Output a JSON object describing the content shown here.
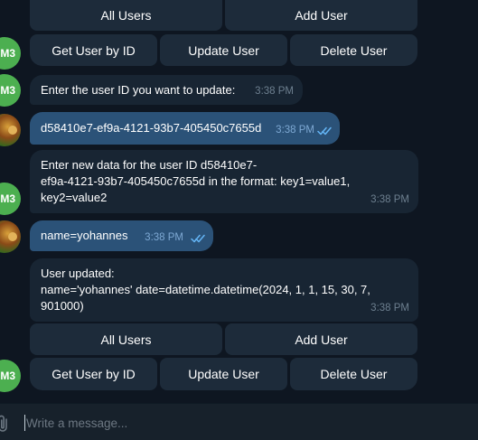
{
  "colors": {
    "background": "#0e1621",
    "incoming_bubble": "#182533",
    "outgoing_bubble": "#2b5278",
    "keyboard_button": "#1d2b3a",
    "bot_avatar": "#4caf50",
    "read_ticks": "#64b5f6"
  },
  "bot": {
    "avatar_initials": "M3"
  },
  "keyboard_top": {
    "row1": [
      "All Users",
      "Add User"
    ],
    "row2": [
      "Get User by ID",
      "Update User",
      "Delete User"
    ]
  },
  "messages": [
    {
      "from": "bot",
      "text": "Enter the user ID you want to update:",
      "time": "3:38 PM"
    },
    {
      "from": "user",
      "text": "d58410e7-ef9a-4121-93b7-405450c7655d",
      "time": "3:38 PM",
      "status": "read"
    },
    {
      "from": "bot",
      "text": "Enter new data for the user ID d58410e7-\nef9a-4121-93b7-405450c7655d in the format: key1=value1,\nkey2=value2",
      "time": "3:38 PM"
    },
    {
      "from": "user",
      "text": "name=yohannes",
      "time": "3:38 PM",
      "status": "read"
    },
    {
      "from": "bot",
      "text": "User updated:\nname='yohannes' date=datetime.datetime(2024, 1, 1, 15, 30, 7,\n901000)",
      "time": "3:38 PM"
    }
  ],
  "keyboard_bottom": {
    "row1": [
      "All Users",
      "Add User"
    ],
    "row2": [
      "Get User by ID",
      "Update User",
      "Delete User"
    ]
  },
  "composer": {
    "placeholder": "Write a message...",
    "icon": "paperclip-icon"
  }
}
